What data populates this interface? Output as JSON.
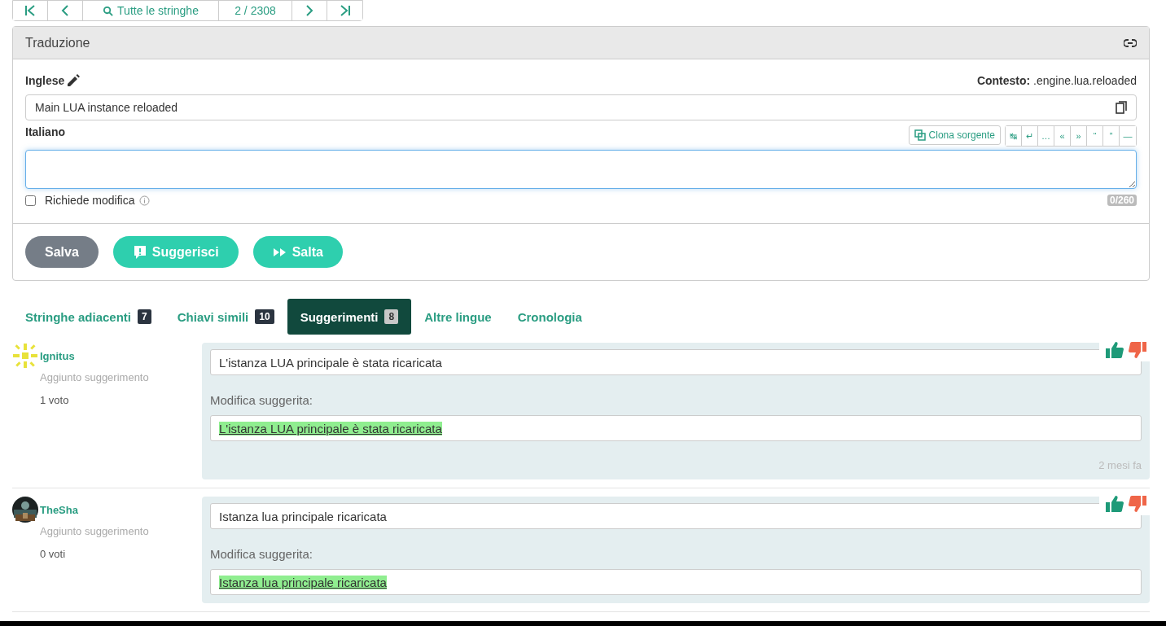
{
  "nav": {
    "filter": "Tutte le stringhe",
    "position": "2 / 2308"
  },
  "translation": {
    "title": "Traduzione",
    "source_label": "Inglese",
    "context_label": "Contesto:",
    "context_value": ".engine.lua.reloaded",
    "source_text": "Main LUA instance reloaded",
    "target_label": "Italiano",
    "clone_button": "Clona sorgente",
    "special_chars": [
      "↹",
      "↵",
      "…",
      "«",
      "»",
      "“",
      "”",
      "—"
    ],
    "needs_editing": {
      "label": "Richiede modifica",
      "checked": false
    },
    "counter": "0/260",
    "buttons": [
      {
        "label": "Salva",
        "kind": "save"
      },
      {
        "label": "Suggerisci",
        "kind": "suggest"
      },
      {
        "label": "Salta",
        "kind": "skip"
      }
    ]
  },
  "tabs": [
    {
      "label": "Stringhe adiacenti",
      "count": "7",
      "selected": false
    },
    {
      "label": "Chiavi simili",
      "count": "10",
      "selected": false
    },
    {
      "label": "Suggerimenti",
      "count": "8",
      "selected": true
    },
    {
      "label": "Altre lingue",
      "selected": false
    },
    {
      "label": "Cronologia",
      "selected": false
    }
  ],
  "suggestions": [
    {
      "user": "Ignitus",
      "kind": "pattern",
      "action": "Aggiunto suggerimento",
      "votes": "1 voto",
      "text": "L'istanza LUA principale è stata ricaricata",
      "suggested_label": "Modifica suggerita:",
      "diff": "L'istanza LUA principale è stata ricaricata",
      "age": "2 mesi fa"
    },
    {
      "user": "TheSha",
      "action": "Aggiunto suggerimento",
      "votes": "0 voti",
      "text": "Istanza lua principale ricaricata",
      "suggested_label": "Modifica suggerita:",
      "diff": "Istanza lua principale ricaricata"
    }
  ]
}
